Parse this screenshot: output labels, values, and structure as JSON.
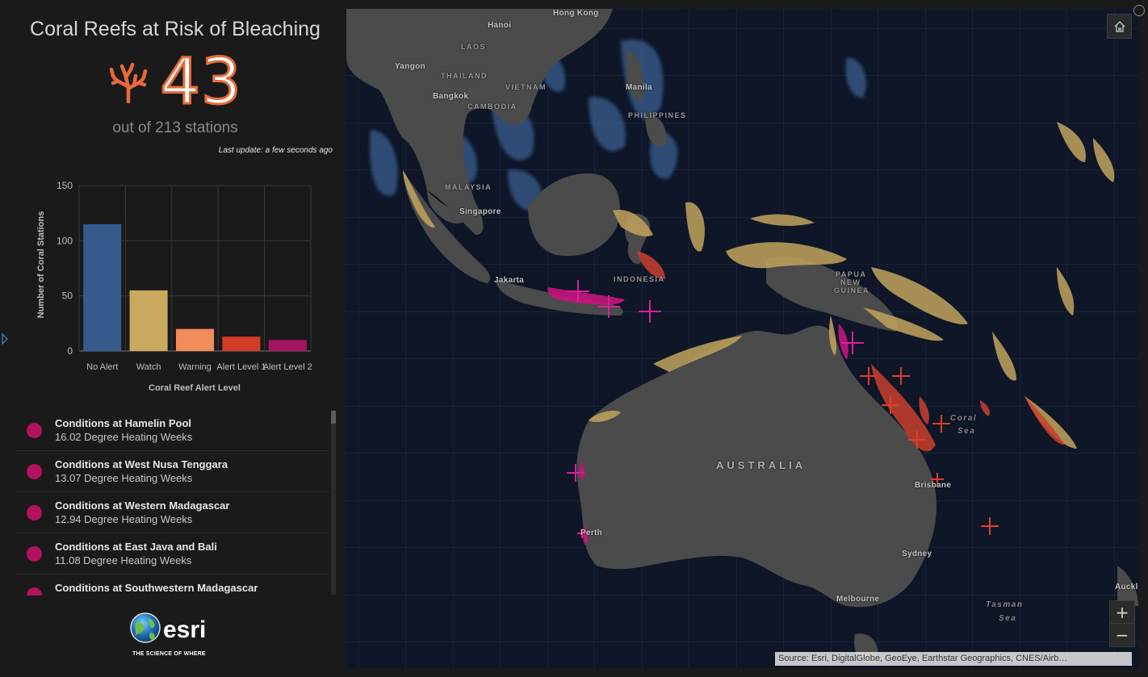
{
  "panel": {
    "title": "Coral Reefs at Risk of Bleaching",
    "count": "43",
    "subtitle": "out of 213 stations",
    "last_update_label": "Last update:",
    "last_update_value": "a few seconds ago",
    "icon": "coral-icon",
    "accent_color": "#e86a3a"
  },
  "chart_data": {
    "type": "bar",
    "categories": [
      "No Alert",
      "Watch",
      "Warning",
      "Alert Level 1",
      "Alert Level 2"
    ],
    "values": [
      115,
      55,
      20,
      13,
      10
    ],
    "colors": [
      "#355a8c",
      "#c9a95e",
      "#f28c5a",
      "#d43c28",
      "#a3155e"
    ],
    "xlabel": "Coral Reef Alert Level",
    "ylabel": "Number of Coral Stations",
    "ylim": [
      0,
      150
    ],
    "yticks": [
      "0",
      "50",
      "100",
      "150"
    ],
    "grid": true
  },
  "list": {
    "items": [
      {
        "title": "Conditions at Hamelin Pool",
        "value": "16.02 Degree Heating Weeks"
      },
      {
        "title": "Conditions at West Nusa Tenggara",
        "value": "13.07 Degree Heating Weeks"
      },
      {
        "title": "Conditions at Western Madagascar",
        "value": "12.94 Degree Heating Weeks"
      },
      {
        "title": "Conditions at East Java and Bali",
        "value": "11.08 Degree Heating Weeks"
      },
      {
        "title": "Conditions at Southwestern Madagascar",
        "value": ""
      }
    ]
  },
  "logo": {
    "name": "esri",
    "tagline": "THE SCIENCE OF WHERE"
  },
  "map": {
    "labels": {
      "hong_kong": "Hong Kong",
      "hanoi": "Hanoi",
      "laos": "LAOS",
      "yangon": "Yangon",
      "thailand": "THAILAND",
      "vietnam": "VIETNAM",
      "manila": "Manila",
      "bangkok": "Bangkok",
      "cambodia": "CAMBODIA",
      "philippines": "PHILIPPINES",
      "malaysia": "MALAYSIA",
      "singapore": "Singapore",
      "jakarta": "Jakarta",
      "indonesia": "INDONESIA",
      "papua": "PAPUA",
      "new": "NEW",
      "guinea": "GUINEA",
      "australia": "AUSTRALIA",
      "coral_sea_1": "Coral",
      "coral_sea_2": "Sea",
      "brisbane": "Brisbane",
      "perth": "Perth",
      "sydney": "Sydney",
      "melbourne": "Melbourne",
      "tasman_1": "Tasman",
      "tasman_2": "Sea",
      "auckland": "Auckl"
    },
    "zoom_in": "+",
    "zoom_out": "−",
    "attribution": "Source: Esri, DigitalGlobe, GeoEye, Earthstar Geographics, CNES/Airb…"
  }
}
